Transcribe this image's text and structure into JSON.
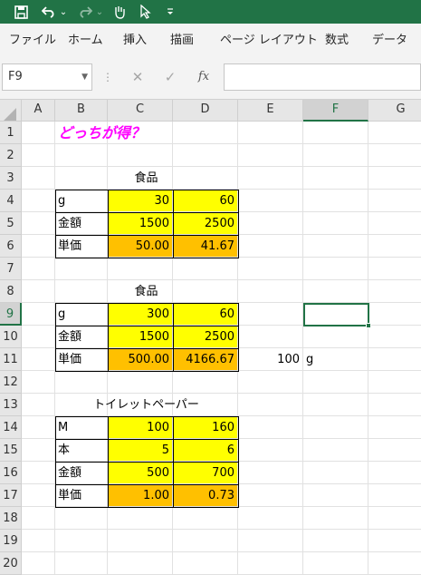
{
  "quick_access": {
    "save_icon": "save-icon",
    "undo_icon": "undo-icon",
    "redo_icon": "redo-icon",
    "touch_icon": "touch-mode-icon",
    "pointer_icon": "pointer-icon",
    "customize_icon": "customize-qat-icon",
    "dropdown": "⌄"
  },
  "menu": [
    "ファイル",
    "ホーム",
    "挿入",
    "描画",
    "ページ レイアウト",
    "数式",
    "データ"
  ],
  "formula_bar": {
    "name_box": "F9",
    "cancel": "✕",
    "enter": "✓",
    "function": "fx",
    "content": ""
  },
  "columns": [
    "A",
    "B",
    "C",
    "D",
    "E",
    "F",
    "G"
  ],
  "rows": [
    "1",
    "2",
    "3",
    "4",
    "5",
    "6",
    "7",
    "8",
    "9",
    "10",
    "11",
    "12",
    "13",
    "14",
    "15",
    "16",
    "17",
    "18",
    "19",
    "20"
  ],
  "active_cell": {
    "column": "F",
    "row": "9"
  },
  "cells": [
    {
      "col": "B",
      "row": 1,
      "text": "どっちが得？",
      "style": "title"
    },
    {
      "col": "C",
      "row": 3,
      "text": "食品",
      "style": "center"
    },
    {
      "col": "B",
      "row": 4,
      "text": "g",
      "style": "label"
    },
    {
      "col": "C",
      "row": 4,
      "text": "30",
      "style": "yellow"
    },
    {
      "col": "D",
      "row": 4,
      "text": "60",
      "style": "yellow"
    },
    {
      "col": "B",
      "row": 5,
      "text": "金額",
      "style": "label"
    },
    {
      "col": "C",
      "row": 5,
      "text": "1500",
      "style": "yellow"
    },
    {
      "col": "D",
      "row": 5,
      "text": "2500",
      "style": "yellow"
    },
    {
      "col": "B",
      "row": 6,
      "text": "単価",
      "style": "label"
    },
    {
      "col": "C",
      "row": 6,
      "text": "50.00",
      "style": "orange"
    },
    {
      "col": "D",
      "row": 6,
      "text": "41.67",
      "style": "orange"
    },
    {
      "col": "C",
      "row": 8,
      "text": "食品",
      "style": "center"
    },
    {
      "col": "B",
      "row": 9,
      "text": "g",
      "style": "label"
    },
    {
      "col": "C",
      "row": 9,
      "text": "300",
      "style": "yellow"
    },
    {
      "col": "D",
      "row": 9,
      "text": "60",
      "style": "yellow"
    },
    {
      "col": "B",
      "row": 10,
      "text": "金額",
      "style": "label"
    },
    {
      "col": "C",
      "row": 10,
      "text": "1500",
      "style": "yellow"
    },
    {
      "col": "D",
      "row": 10,
      "text": "2500",
      "style": "yellow"
    },
    {
      "col": "B",
      "row": 11,
      "text": "単価",
      "style": "label"
    },
    {
      "col": "C",
      "row": 11,
      "text": "500.00",
      "style": "orange"
    },
    {
      "col": "D",
      "row": 11,
      "text": "4166.67",
      "style": "orange"
    },
    {
      "col": "E",
      "row": 11,
      "text": "100",
      "style": "num"
    },
    {
      "col": "F",
      "row": 11,
      "text": "g",
      "style": "plain"
    },
    {
      "col": "C",
      "row": 13,
      "text": "トイレットペーパー",
      "style": "center"
    },
    {
      "col": "B",
      "row": 14,
      "text": "M",
      "style": "label"
    },
    {
      "col": "C",
      "row": 14,
      "text": "100",
      "style": "yellow"
    },
    {
      "col": "D",
      "row": 14,
      "text": "160",
      "style": "yellow"
    },
    {
      "col": "B",
      "row": 15,
      "text": "本",
      "style": "label"
    },
    {
      "col": "C",
      "row": 15,
      "text": "5",
      "style": "yellow"
    },
    {
      "col": "D",
      "row": 15,
      "text": "6",
      "style": "yellow"
    },
    {
      "col": "B",
      "row": 16,
      "text": "金額",
      "style": "label"
    },
    {
      "col": "C",
      "row": 16,
      "text": "500",
      "style": "yellow"
    },
    {
      "col": "D",
      "row": 16,
      "text": "700",
      "style": "yellow"
    },
    {
      "col": "B",
      "row": 17,
      "text": "単価",
      "style": "label"
    },
    {
      "col": "C",
      "row": 17,
      "text": "1.00",
      "style": "orange"
    },
    {
      "col": "D",
      "row": 17,
      "text": "0.73",
      "style": "orange"
    }
  ],
  "bordered_tables": [
    [
      4,
      6
    ],
    [
      9,
      11
    ],
    [
      14,
      17
    ]
  ],
  "colors": {
    "title": "#ff00ff",
    "input_fill": "#ffff00",
    "result_fill": "#ffc000",
    "accent": "#217346"
  }
}
